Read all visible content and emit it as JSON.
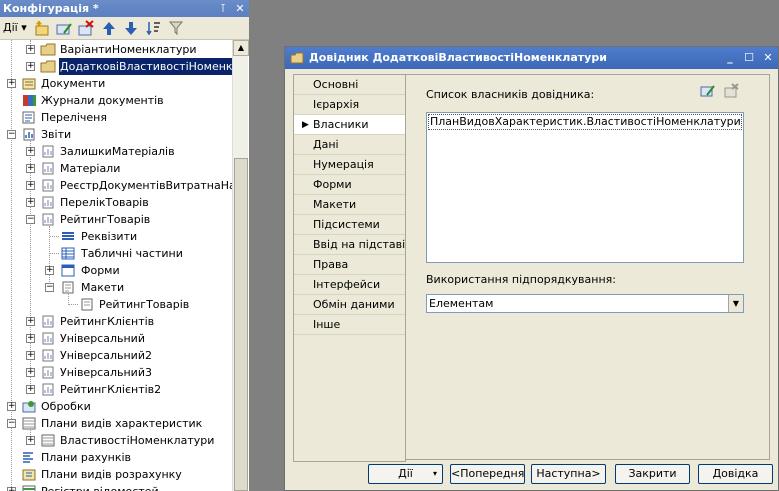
{
  "config_panel": {
    "title": "Конфігурація *",
    "pin_glyph": "⊺",
    "close_glyph": "✕",
    "actions_label": "Дії",
    "dropdown_glyph": "▾",
    "toolbar_icons": [
      "add-icon",
      "edit-icon",
      "delete-icon",
      "move-up-icon",
      "move-down-icon",
      "sort-icon",
      "filter-icon"
    ],
    "up_glyph": "▲",
    "tree": [
      {
        "label": "ВаріантиНоменклатури",
        "icon": "folder-icon"
      },
      {
        "label": "ДодатковіВластивостіНоменклатури",
        "icon": "folder-icon",
        "selected": true
      },
      {
        "label": "Документи",
        "icon": "documents-icon"
      },
      {
        "label": "Журнали документів",
        "icon": "journals-icon"
      },
      {
        "label": "Переліченя",
        "icon": "enums-icon"
      },
      {
        "label": "Звіти",
        "icon": "reports-icon"
      },
      {
        "label": "ЗалишкиМатеріалів",
        "icon": "report-icon"
      },
      {
        "label": "Матеріали",
        "icon": "report-icon"
      },
      {
        "label": "РеєстрДокументівВитратнаНакла",
        "icon": "report-icon"
      },
      {
        "label": "ПерелікТоварів",
        "icon": "report-icon"
      },
      {
        "label": "РейтингТоварів",
        "icon": "report-icon"
      },
      {
        "label": "Реквізити",
        "icon": "attributes-icon"
      },
      {
        "label": "Табличні частини",
        "icon": "tabular-icon"
      },
      {
        "label": "Форми",
        "icon": "forms-icon"
      },
      {
        "label": "Макети",
        "icon": "templates-icon"
      },
      {
        "label": "РейтингТоварів",
        "icon": "template-icon"
      },
      {
        "label": "РейтингКлієнтів",
        "icon": "report-icon"
      },
      {
        "label": "Універсальний",
        "icon": "report-icon"
      },
      {
        "label": "Універсальний2",
        "icon": "report-icon"
      },
      {
        "label": "Універсальний3",
        "icon": "report-icon"
      },
      {
        "label": "РейтингКлієнтів2",
        "icon": "report-icon"
      },
      {
        "label": "Обробки",
        "icon": "processing-icon"
      },
      {
        "label": "Плани видів характеристик",
        "icon": "char-plans-icon"
      },
      {
        "label": "ВластивостіНоменклатури",
        "icon": "folder-icon"
      },
      {
        "label": "Плани рахунків",
        "icon": "accounts-icon"
      },
      {
        "label": "Плани видів розрахунку",
        "icon": "calc-plans-icon"
      },
      {
        "label": "Регістри відомостей",
        "icon": "registers-icon"
      }
    ]
  },
  "dialog": {
    "title": "Довідник ДодатковіВластивостіНоменклатури",
    "window_glyphs": {
      "minimize": "_",
      "maximize": "☐",
      "close": "✕"
    },
    "nav_marker": "▶",
    "nav_items": [
      {
        "label": "Основні"
      },
      {
        "label": "Ієрархія"
      },
      {
        "label": "Власники",
        "active": true
      },
      {
        "label": "Дані"
      },
      {
        "label": "Нумерація"
      },
      {
        "label": "Форми"
      },
      {
        "label": "Макети"
      },
      {
        "label": "Підсистеми"
      },
      {
        "label": "Ввід на підставі"
      },
      {
        "label": "Права"
      },
      {
        "label": "Інтерфейси"
      },
      {
        "label": "Обмін даними"
      },
      {
        "label": "Інше"
      }
    ],
    "owners_label": "Список власників довідника:",
    "owners": [
      "ПланВидовХарактеристик.ВластивостіНоменклатури"
    ],
    "subordination_label": "Використання підпорядкування:",
    "subordination_value": "Елементам",
    "dropdown_glyph": "▼",
    "buttons": {
      "actions": "Дії",
      "prev": "<Попередня",
      "next": "Наступна>",
      "close": "Закрити",
      "help": "Довідка"
    }
  }
}
